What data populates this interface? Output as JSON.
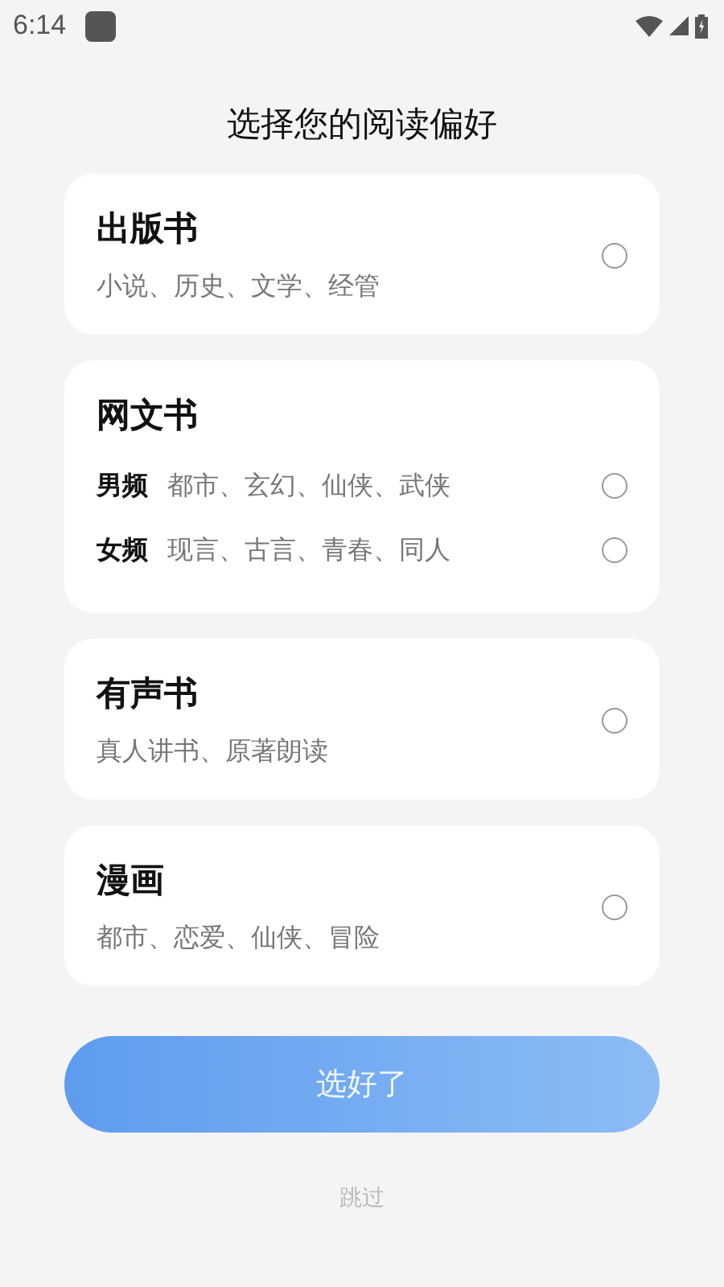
{
  "status_bar": {
    "time": "6:14"
  },
  "title": "选择您的阅读偏好",
  "categories": [
    {
      "kind": "single",
      "title": "出版书",
      "subtitle": "小说、历史、文学、经管",
      "selected": false
    },
    {
      "kind": "multi",
      "title": "网文书",
      "options": [
        {
          "label": "男频",
          "genres": "都市、玄幻、仙侠、武侠",
          "selected": false
        },
        {
          "label": "女频",
          "genres": "现言、古言、青春、同人",
          "selected": false
        }
      ]
    },
    {
      "kind": "single",
      "title": "有声书",
      "subtitle": "真人讲书、原著朗读",
      "selected": false
    },
    {
      "kind": "single",
      "title": "漫画",
      "subtitle": "都市、恋爱、仙侠、冒险",
      "selected": false
    }
  ],
  "confirm_button": {
    "label": "选好了",
    "disabled": true
  },
  "skip_link": "跳过"
}
